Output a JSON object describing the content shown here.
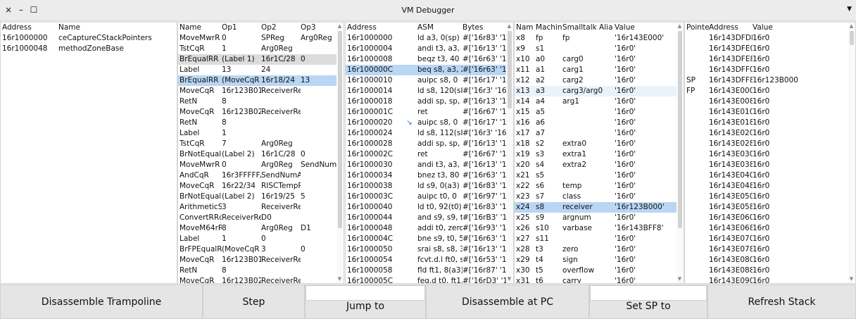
{
  "window": {
    "title": "VM Debugger",
    "close": "×",
    "minimize": "–",
    "maximize": "☐",
    "menu": "▼"
  },
  "methods": {
    "headers": [
      "Address",
      "Name"
    ],
    "rows": [
      [
        "16r1000000",
        "ceCaptureCStackPointers"
      ],
      [
        "16r1000048",
        "methodZoneBase"
      ]
    ]
  },
  "ir": {
    "headers": [
      "Name",
      "Op1",
      "Op2",
      "Op3"
    ],
    "rows": [
      [
        "MoveMwrR",
        "0",
        "SPReg",
        "Arg0Reg"
      ],
      [
        "TstCqR",
        "1",
        "Arg0Reg",
        ""
      ],
      [
        "BrEqualRR",
        "(Label 1)",
        "16r1C/28",
        "0"
      ],
      [
        "Label",
        "13",
        "24",
        ""
      ],
      [
        "BrEqualRR",
        "(MoveCqR 1",
        "16r18/24",
        "13"
      ],
      [
        "MoveCqR",
        "16r123B010/",
        "ReceiverResı",
        ""
      ],
      [
        "RetN",
        "8",
        "",
        ""
      ],
      [
        "MoveCqR",
        "16r123B020/",
        "ReceiverResı",
        ""
      ],
      [
        "RetN",
        "8",
        "",
        ""
      ],
      [
        "Label",
        "1",
        "",
        ""
      ],
      [
        "TstCqR",
        "7",
        "Arg0Reg",
        ""
      ],
      [
        "BrNotEqualF",
        "(Label 2)",
        "16r1C/28",
        "0"
      ],
      [
        "MoveMwrR",
        "0",
        "Arg0Reg",
        "SendNumAr"
      ],
      [
        "AndCqR",
        "16r3FFFFF/4",
        "SendNumAr(",
        ""
      ],
      [
        "MoveCqR",
        "16r22/34",
        "RISCTempRe",
        ""
      ],
      [
        "BrNotEqualF",
        "(Label 2)",
        "16r19/25",
        "5"
      ],
      [
        "ArithmeticSh",
        "3",
        "ReceiverResı",
        ""
      ],
      [
        "ConvertRRd",
        "ReceiverResı",
        "D0",
        ""
      ],
      [
        "MoveM64rRc",
        "8",
        "Arg0Reg",
        "D1"
      ],
      [
        "Label",
        "1",
        "0",
        ""
      ],
      [
        "BrFPEqualRF",
        "(MoveCqR 1",
        "3",
        "0"
      ],
      [
        "MoveCqR",
        "16r123B010/",
        "ReceiverResı",
        ""
      ],
      [
        "RetN",
        "8",
        "",
        ""
      ],
      [
        "MoveCqR",
        "16r123B020/",
        "ReceiverResı",
        ""
      ]
    ]
  },
  "asm": {
    "headers": [
      "Address",
      "ASM",
      "Bytes"
    ],
    "pc_marker": "↘",
    "rows": [
      [
        "16r1000000",
        "ld a3, 0(sp)",
        "#['16r83' '16r3"
      ],
      [
        "16r1000004",
        "andi t3, a3, 1",
        "#['16r13' '16rF"
      ],
      [
        "16r1000008",
        "beqz t3, 40",
        "#['16r63' '16r4"
      ],
      [
        "16r100000C",
        "beq s8, a3, 20",
        "#['16r63' '16rA"
      ],
      [
        "16r1000010",
        "auipc s8, 0",
        "#['16r17' '16rC"
      ],
      [
        "16r1000014",
        "ld s8, 120(s8)",
        "#['16r3' '16r3C"
      ],
      [
        "16r1000018",
        "addi sp, sp, 8",
        "#['16r13' '16r1"
      ],
      [
        "16r100001C",
        "ret",
        "#['16r67' '16r8"
      ],
      [
        "16r1000020",
        "auipc s8, 0",
        "#['16r17' '16rC"
      ],
      [
        "16r1000024",
        "ld s8, 112(s8)",
        "#['16r3' '16r3C"
      ],
      [
        "16r1000028",
        "addi sp, sp, 8",
        "#['16r13' '16r1"
      ],
      [
        "16r100002C",
        "ret",
        "#['16r67' '16r8"
      ],
      [
        "16r1000030",
        "andi t3, a3, 7",
        "#['16r13' '16rF"
      ],
      [
        "16r1000034",
        "bnez t3, 80",
        "#['16r63' '16r1"
      ],
      [
        "16r1000038",
        "ld s9, 0(a3)",
        "#['16r83' '16rE"
      ],
      [
        "16r100003C",
        "auipc t0, 0",
        "#['16r97' '16r2"
      ],
      [
        "16r1000040",
        "ld t0, 92(t0)",
        "#['16r83' '16rE"
      ],
      [
        "16r1000044",
        "and s9, s9, t0",
        "#['16rB3' '16rF"
      ],
      [
        "16r1000048",
        "addi t0, zero, 3",
        "#['16r93' '16r2"
      ],
      [
        "16r100004C",
        "bne s9, t0, 56",
        "#['16r63' '16r9"
      ],
      [
        "16r1000050",
        "srai s8, s8, 3",
        "#['16r13' '16r5"
      ],
      [
        "16r1000054",
        "fcvt.d.l ft0, s8",
        "#['16r53' '16r7"
      ],
      [
        "16r1000058",
        "fld ft1, 8(a3)",
        "#['16r87' '16rE"
      ],
      [
        "16r100005C",
        "feq.d t0, ft1, ft",
        "#['16rD3' '16rA"
      ]
    ]
  },
  "regs": {
    "headers": [
      "Nam",
      "Machine Al",
      "Smalltalk Alia",
      "Value"
    ],
    "rows": [
      [
        "x8",
        "fp",
        "fp",
        "'16r143E000'"
      ],
      [
        "x9",
        "s1",
        "",
        "'16r0'"
      ],
      [
        "x10",
        "a0",
        "carg0",
        "'16r0'"
      ],
      [
        "x11",
        "a1",
        "carg1",
        "'16r0'"
      ],
      [
        "x12",
        "a2",
        "carg2",
        "'16r0'"
      ],
      [
        "x13",
        "a3",
        "carg3/arg0",
        "'16r0'"
      ],
      [
        "x14",
        "a4",
        "arg1",
        "'16r0'"
      ],
      [
        "x15",
        "a5",
        "",
        "'16r0'"
      ],
      [
        "x16",
        "a6",
        "",
        "'16r0'"
      ],
      [
        "x17",
        "a7",
        "",
        "'16r0'"
      ],
      [
        "x18",
        "s2",
        "extra0",
        "'16r0'"
      ],
      [
        "x19",
        "s3",
        "extra1",
        "'16r0'"
      ],
      [
        "x20",
        "s4",
        "extra2",
        "'16r0'"
      ],
      [
        "x21",
        "s5",
        "",
        "'16r0'"
      ],
      [
        "x22",
        "s6",
        "temp",
        "'16r0'"
      ],
      [
        "x23",
        "s7",
        "class",
        "'16r0'"
      ],
      [
        "x24",
        "s8",
        "receiver",
        "'16r123B000'"
      ],
      [
        "x25",
        "s9",
        "argnum",
        "'16r0'"
      ],
      [
        "x26",
        "s10",
        "varbase",
        "'16r143BFF8'"
      ],
      [
        "x27",
        "s11",
        "",
        "'16r0'"
      ],
      [
        "x28",
        "t3",
        "zero",
        "'16r0'"
      ],
      [
        "x29",
        "t4",
        "sign",
        "'16r0'"
      ],
      [
        "x30",
        "t5",
        "overflow",
        "'16r0'"
      ],
      [
        "x31",
        "t6",
        "carry",
        "'16r0'"
      ]
    ]
  },
  "stack": {
    "headers": [
      "Pointe",
      "Address",
      "Value"
    ],
    "rows": [
      [
        "",
        "16r143DFD8",
        "16r0"
      ],
      [
        "",
        "16r143DFE0",
        "16r0"
      ],
      [
        "",
        "16r143DFE8",
        "16r0"
      ],
      [
        "",
        "16r143DFF0",
        "16r0"
      ],
      [
        "SP",
        "16r143DFF8",
        "16r123B000"
      ],
      [
        "FP",
        "16r143E000",
        "16r0"
      ],
      [
        "",
        "16r143E008",
        "16r0"
      ],
      [
        "",
        "16r143E010",
        "16r0"
      ],
      [
        "",
        "16r143E018",
        "16r0"
      ],
      [
        "",
        "16r143E020",
        "16r0"
      ],
      [
        "",
        "16r143E028",
        "16r0"
      ],
      [
        "",
        "16r143E030",
        "16r0"
      ],
      [
        "",
        "16r143E038",
        "16r0"
      ],
      [
        "",
        "16r143E040",
        "16r0"
      ],
      [
        "",
        "16r143E048",
        "16r0"
      ],
      [
        "",
        "16r143E050",
        "16r0"
      ],
      [
        "",
        "16r143E058",
        "16r0"
      ],
      [
        "",
        "16r143E060",
        "16r0"
      ],
      [
        "",
        "16r143E068",
        "16r0"
      ],
      [
        "",
        "16r143E070",
        "16r0"
      ],
      [
        "",
        "16r143E078",
        "16r0"
      ],
      [
        "",
        "16r143E080",
        "16r0"
      ],
      [
        "",
        "16r143E088",
        "16r0"
      ],
      [
        "",
        "16r143E090",
        "16r0"
      ]
    ]
  },
  "buttons": {
    "disassemble_trampoline": "Disassemble Trampoline",
    "step": "Step",
    "jump_to": "Jump to",
    "disassemble_at_pc": "Disassemble at PC",
    "set_sp_to": "Set SP to",
    "refresh_stack": "Refresh Stack"
  },
  "fields": {
    "jump_to_value": "",
    "set_sp_value": ""
  }
}
